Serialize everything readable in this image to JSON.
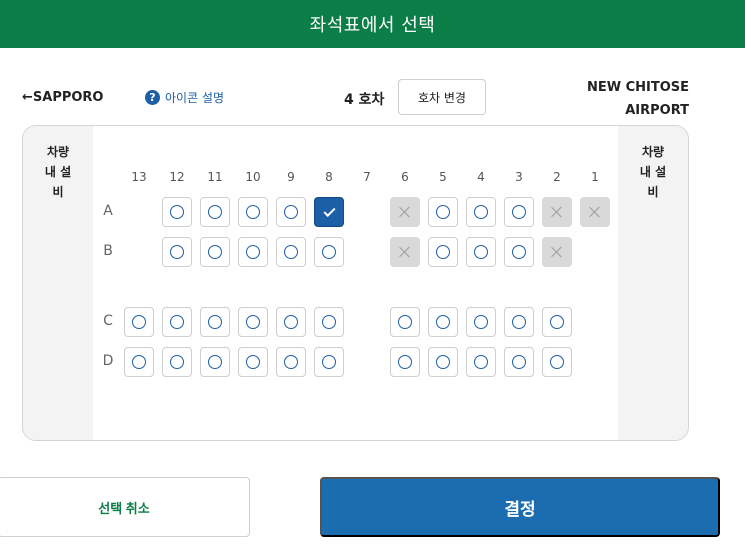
{
  "header": {
    "title": "좌석표에서 선택"
  },
  "nav": {
    "back_label": "←SAPPORO",
    "legend_label": "아이콘 설명",
    "help_glyph": "?",
    "car_label": "4 호차",
    "car_change_label": "호차 변경",
    "dest_line1": "NEW CHITOSE",
    "dest_line2": "AIRPORT"
  },
  "sides": {
    "left_lines": [
      "차량",
      "내 설",
      "비"
    ],
    "right_lines": [
      "차량",
      "내 설",
      "비"
    ]
  },
  "seatmap": {
    "columns": [
      "13",
      "12",
      "11",
      "10",
      "9",
      "8",
      "7",
      "6",
      "5",
      "4",
      "3",
      "2",
      "1"
    ],
    "rows": [
      {
        "label": "A",
        "seats": [
          "none",
          "available",
          "available",
          "available",
          "available",
          "selected",
          "none",
          "taken",
          "available",
          "available",
          "available",
          "taken",
          "taken"
        ]
      },
      {
        "label": "B",
        "seats": [
          "none",
          "available",
          "available",
          "available",
          "available",
          "available",
          "none",
          "taken",
          "available",
          "available",
          "available",
          "taken",
          "none"
        ]
      },
      {
        "label": "C",
        "seats": [
          "available",
          "available",
          "available",
          "available",
          "available",
          "available",
          "none",
          "available",
          "available",
          "available",
          "available",
          "available",
          "none"
        ]
      },
      {
        "label": "D",
        "seats": [
          "available",
          "available",
          "available",
          "available",
          "available",
          "available",
          "none",
          "available",
          "available",
          "available",
          "available",
          "available",
          "none"
        ]
      }
    ]
  },
  "footer": {
    "cancel_label": "선택 취소",
    "confirm_label": "결정"
  },
  "colors": {
    "header_green": "#0b7d46",
    "accent_blue": "#1c5fa6",
    "confirm_blue": "#1c6cb0",
    "taken_gray": "#d9d9d9"
  }
}
